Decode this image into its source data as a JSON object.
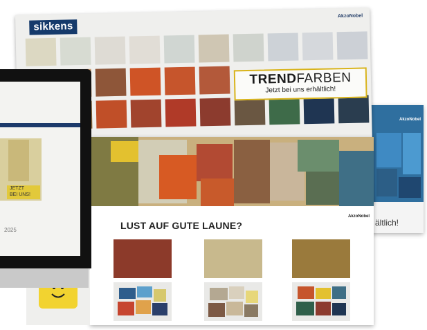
{
  "poster": {
    "brand": "sikkens",
    "company": "AkzoNobel",
    "trend_bold": "TREND",
    "trend_rest": "FARBEN",
    "subtitle": "Jetzt bei uns erhältlich!"
  },
  "sheet": {
    "headline": "LUST AUF GUTE LAUNE?",
    "company": "AkzoNobel"
  },
  "back_card": {
    "company": "AkzoNobel",
    "text_fragment": "ältlich!"
  },
  "monitor": {
    "screen_tag_line1": "JETZT",
    "screen_tag_line2": "BEI UNS!",
    "screen_year": "2025"
  },
  "colors": {
    "brand_navy": "#153a6b",
    "accent_yellow": "#d8b31b"
  }
}
